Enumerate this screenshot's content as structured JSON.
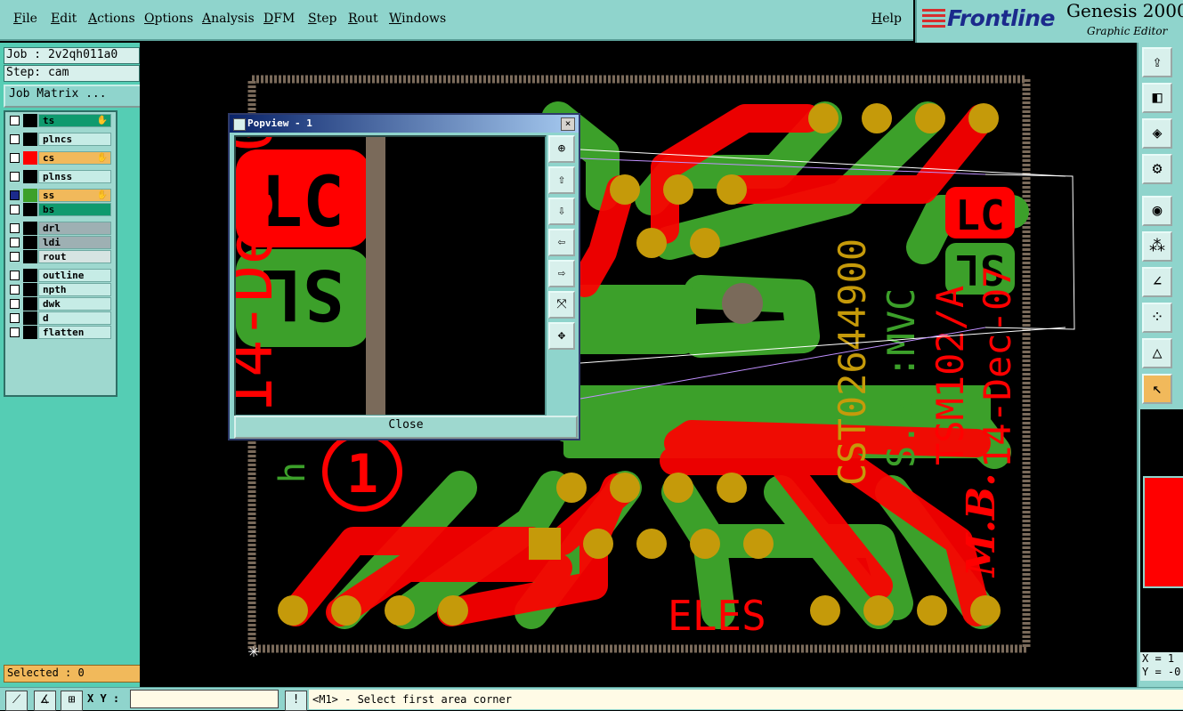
{
  "menu": [
    "File",
    "Edit",
    "Actions",
    "Options",
    "Analysis",
    "DFM",
    "Step",
    "Rout",
    "Windows"
  ],
  "help_label": "Help",
  "brand": {
    "logo": "Frontline",
    "product": "Genesis 2000",
    "subtitle": "Graphic Editor"
  },
  "job": {
    "job_label": "Job : 2v2qh011a0",
    "step_label": "Step: cam",
    "matrix_button": "Job Matrix ..."
  },
  "layers": [
    {
      "name": "ts",
      "color": "#0f9a6e",
      "swatch": "#000000",
      "affected": true
    },
    {
      "name": "plncs",
      "color": "#c6ece6",
      "swatch": "#000000",
      "affected": false
    },
    {
      "name": "cs",
      "color": "#f1b95b",
      "swatch": "#ff0000",
      "affected": true
    },
    {
      "name": "plnss",
      "color": "#c6ece6",
      "swatch": "#000000",
      "affected": false
    },
    {
      "name": "ss",
      "color": "#f1b95b",
      "swatch": "#3ca02a",
      "affected": true
    },
    {
      "name": "bs",
      "color": "#0f9a6e",
      "swatch": "#000000",
      "affected": false
    },
    {
      "name": "drl",
      "color": "#9eb0b3",
      "swatch": "#000000",
      "affected": false
    },
    {
      "name": "ldi",
      "color": "#9eb0b3",
      "swatch": "#000000",
      "affected": false
    },
    {
      "name": "rout",
      "color": "#d6e4e2",
      "swatch": "#000000",
      "affected": false
    },
    {
      "name": "outline",
      "color": "#c6ece6",
      "swatch": "#000000",
      "affected": false
    },
    {
      "name": "npth",
      "color": "#c6ece6",
      "swatch": "#000000",
      "affected": false
    },
    {
      "name": "dwk",
      "color": "#c6ece6",
      "swatch": "#000000",
      "affected": false
    },
    {
      "name": "d",
      "color": "#c6ece6",
      "swatch": "#000000",
      "affected": false
    },
    {
      "name": "flatten",
      "color": "#c6ece6",
      "swatch": "#000000",
      "affected": false
    }
  ],
  "selected_label": "Selected : 0",
  "status": {
    "xy_label": "X Y :",
    "xy_value": "",
    "prompt": "<M1> - Select first area corner"
  },
  "coords": {
    "x": "X = 1",
    "y": "Y = -0"
  },
  "popview": {
    "title": "Popview - 1",
    "close_label": "Close",
    "close_x": "×"
  },
  "board_text": {
    "part": "CST02644900",
    "sb": "S.B.:MVC",
    "tsm": "TSM102/A",
    "date": "14-Dec-07",
    "mb": "M.B.",
    "eles": "ELES",
    "lc": "LC",
    "sl": "SL",
    "one": "1",
    "h": "h"
  },
  "colors": {
    "cs": "#ff0000",
    "ss": "#3ca02a",
    "pad": "#c59a0a",
    "outline": "#7a6a5a"
  }
}
